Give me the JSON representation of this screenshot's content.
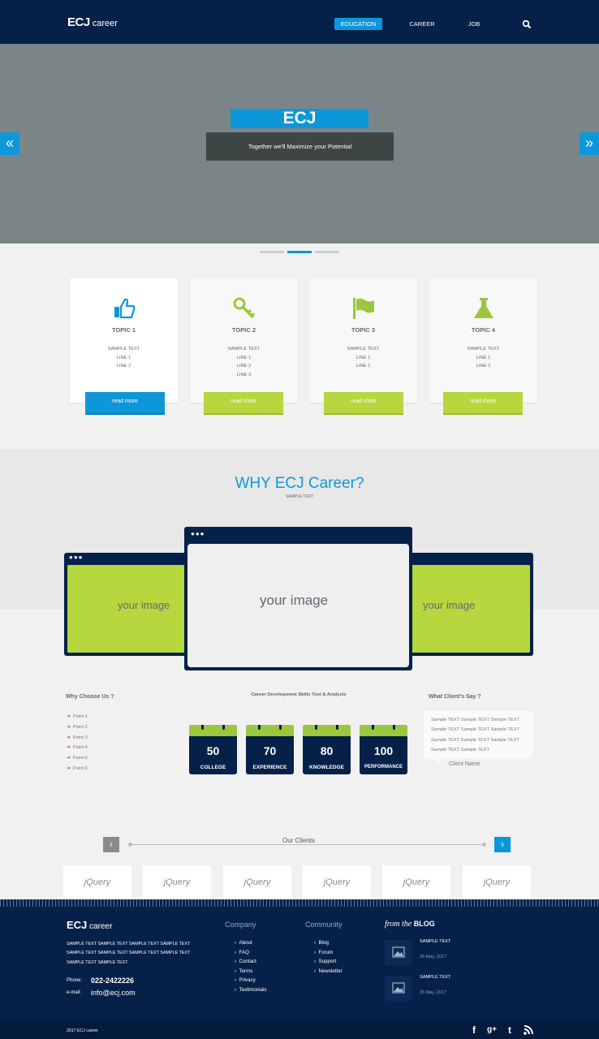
{
  "header": {
    "logo_bold": "ECJ",
    "logo_light": "career",
    "nav": [
      {
        "label": "EDUCATION",
        "active": true
      },
      {
        "label": "CAREER",
        "active": false
      },
      {
        "label": "JOB",
        "active": false
      }
    ],
    "search_icon": "search-icon"
  },
  "hero": {
    "title": "ECJ",
    "subtitle": "Together we'll Maximize your Potential",
    "prev_icon": "double-chevron-left-icon",
    "next_icon": "double-chevron-right-icon",
    "slides": 3,
    "active_slide": 2
  },
  "topics": [
    {
      "title": "TOPIC 1",
      "lines": [
        "SAMPLE TEXT",
        "LINE 1",
        "LINE 2"
      ],
      "button": "read more",
      "icon": "thumbs-up-icon"
    },
    {
      "title": "TOPIC 2",
      "lines": [
        "SAMPLE TEXT",
        "LINE 1",
        "LINE 2",
        "LINE 3"
      ],
      "button": "read more",
      "icon": "key-icon"
    },
    {
      "title": "TOPIC 3",
      "lines": [
        "SAMPLE TEXT",
        "LINE 1",
        "LINE 2"
      ],
      "button": "read more",
      "icon": "flag-icon"
    },
    {
      "title": "TOPIC 4",
      "lines": [
        "SAMPLE TEXT",
        "LINE 1",
        "LINE 2"
      ],
      "button": "read more",
      "icon": "flask-icon"
    }
  ],
  "why": {
    "title": "WHY ECJ Career?",
    "subtitle": "SAMPLE TEXT",
    "images": [
      "your image",
      "your image",
      "your image"
    ]
  },
  "why_choose": {
    "heading": "Why Choose Us ?",
    "points": [
      "Point 1",
      "Point 2",
      "Point 3",
      "Point 4",
      "Point 5",
      "Point 6"
    ]
  },
  "skills": {
    "heading": "Career Development Skills Test & Analysis",
    "stats": [
      {
        "value": "50",
        "label": "COLLEGE"
      },
      {
        "value": "70",
        "label": "EXPERIENCE"
      },
      {
        "value": "80",
        "label": "KNOWLEDGE"
      },
      {
        "value": "100",
        "label": "PERFORMANCE"
      }
    ]
  },
  "testimonial": {
    "heading": "What Client's Say ?",
    "lines": [
      "Sample TEXT Sample TEXT Sample TEXT",
      "Sample TEXT Sample TEXT Sample TEXT",
      "Sample TEXT Sample TEXT Sample TEXT",
      "Sample TEXT Sample TEXT"
    ],
    "client": "Client Name"
  },
  "clients": {
    "title": "Our  Clients",
    "logos": [
      "jQuery",
      "jQuery",
      "jQuery",
      "jQuery",
      "jQuery",
      "jQuery"
    ]
  },
  "footer": {
    "logo_bold": "ECJ",
    "logo_light": "career",
    "description": "SAMPLE TEXT SAMPLE TEXT SAMPLE TEXT SAMPLE TEXT SAMPLE TEXT SAMPLE TEXT SAMPLE TEXT SAMPLE TEXT SAMPLE TEXT SAMPLE TEXT",
    "phone_label": "Phone:",
    "phone": "022-2422226",
    "email_label": "e-mail:",
    "email": "info@ecj.com",
    "company_heading": "Company",
    "company_links": [
      "About",
      "FAQ",
      "Contact",
      "Terms",
      "Privacy",
      "Testimonials"
    ],
    "community_heading": "Community",
    "community_links": [
      "Blog",
      "Forum",
      "Support",
      "Newsletter"
    ],
    "blog_prefix": "from the",
    "blog_word": "BLOG",
    "blog_posts": [
      {
        "title": "SAMPLE TEXT",
        "date": "26 May, 2017"
      },
      {
        "title": "SAMPLE TEXT",
        "date": "26 May, 2017"
      }
    ],
    "copyright": "2017  ECJ career",
    "social": [
      "facebook-icon",
      "google-plus-icon",
      "tumblr-icon",
      "rss-icon"
    ]
  },
  "colors": {
    "navy": "#062149",
    "blue": "#0d97d9",
    "green": "#b6d73e",
    "hero_grey": "#7b8588"
  }
}
